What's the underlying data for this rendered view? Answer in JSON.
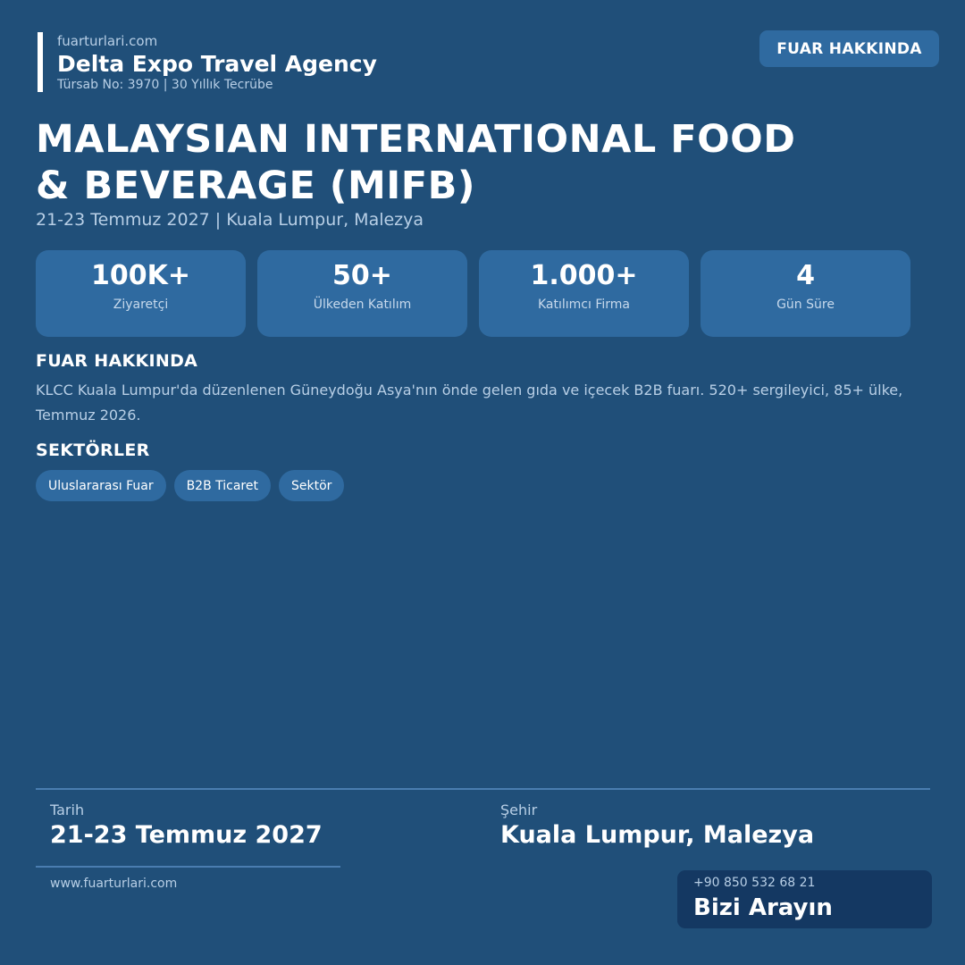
{
  "header": {
    "site": "fuarturlari.com",
    "agency": "Delta Expo Travel Agency",
    "meta": "Türsab No: 3970  |  30 Yıllık Tecrübe",
    "top_button": "FUAR HAKKINDA"
  },
  "event": {
    "title_line1": "MALAYSIAN INTERNATIONAL FOOD",
    "title_line2": "& BEVERAGE (MIFB)",
    "subtitle": "21-23 Temmuz 2027  |  Kuala Lumpur, Malezya"
  },
  "stats": [
    {
      "value": "100K+",
      "label": "Ziyaretçi"
    },
    {
      "value": "50+",
      "label": "Ülkeden Katılım"
    },
    {
      "value": "1.000+",
      "label": "Katılımcı Firma"
    },
    {
      "value": "4",
      "label": "Gün Süre"
    }
  ],
  "about": {
    "heading": "FUAR HAKKINDA",
    "text": "KLCC Kuala Lumpur'da düzenlenen Güneydoğu Asya'nın önde gelen gıda ve içecek B2B fuarı. 520+ sergileyici, 85+ ülke, Temmuz 2026."
  },
  "sectors": {
    "heading": "SEKTÖRLER",
    "tags": [
      "Uluslararası Fuar",
      "B2B Ticaret",
      "Sektör"
    ]
  },
  "footer": {
    "date_label": "Tarih",
    "date_value": "21-23 Temmuz 2027",
    "city_label": "Şehir",
    "city_value": "Kuala Lumpur, Malezya",
    "website": "www.fuarturlari.com",
    "phone": "+90 850 532 68 21",
    "cta": "Bizi Arayın"
  },
  "colors": {
    "background": "#204f79",
    "card": "#2f6aa0",
    "call_box": "#143862"
  }
}
